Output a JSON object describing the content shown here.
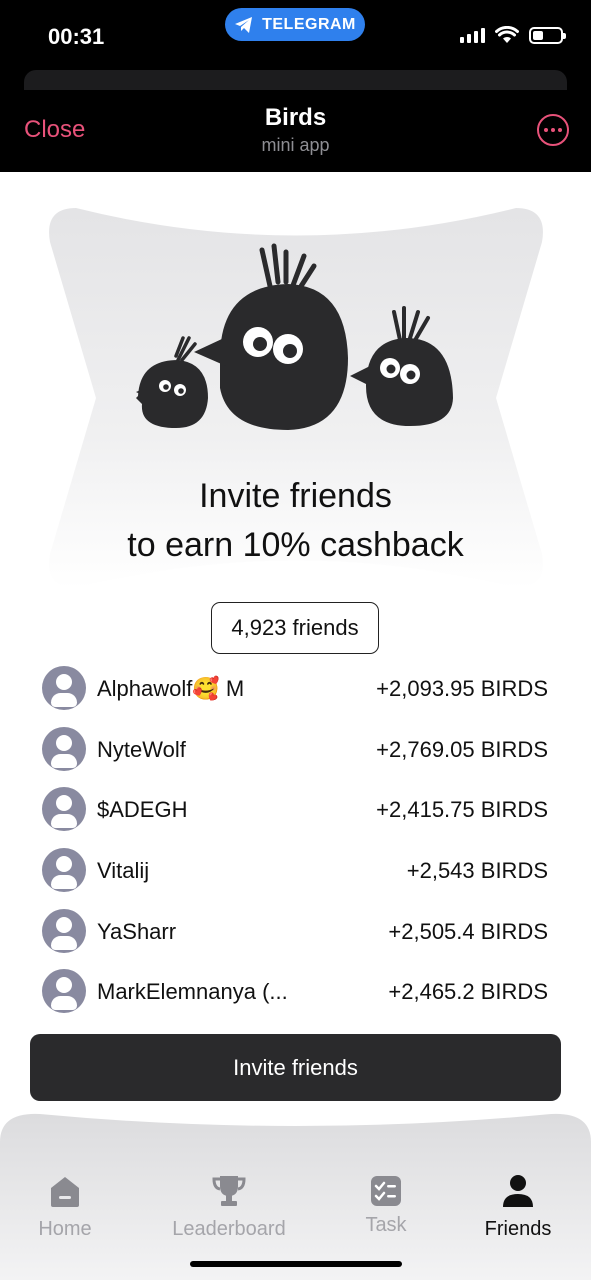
{
  "status_bar": {
    "time": "00:31",
    "pill_label": "TELEGRAM",
    "battery_level_percent": 40
  },
  "header": {
    "close_label": "Close",
    "title": "Birds",
    "subtitle": "mini app"
  },
  "hero": {
    "line1": "Invite friends",
    "line2": "to earn 10% cashback"
  },
  "friends_count": "4,923 friends",
  "friends": [
    {
      "name": "Alphawolf🥰 M",
      "amount": "+2,093.95 BIRDS"
    },
    {
      "name": "NyteWolf",
      "amount": "+2,769.05 BIRDS"
    },
    {
      "name": "$ADEGH",
      "amount": "+2,415.75 BIRDS"
    },
    {
      "name": "Vitalij",
      "amount": "+2,543 BIRDS"
    },
    {
      "name": "YaSharr",
      "amount": "+2,505.4 BIRDS"
    },
    {
      "name": "MarkElemnanya (...",
      "amount": "+2,465.2 BIRDS"
    }
  ],
  "invite_button": "Invite friends",
  "nav": {
    "home": "Home",
    "leaderboard": "Leaderboard",
    "task": "Task",
    "friends": "Friends",
    "active": "friends"
  },
  "colors": {
    "accent": "#e8527a",
    "telegram_pill": "#2f80ed",
    "invite_button": "#2a2a2c",
    "avatar": "#898aa0"
  }
}
